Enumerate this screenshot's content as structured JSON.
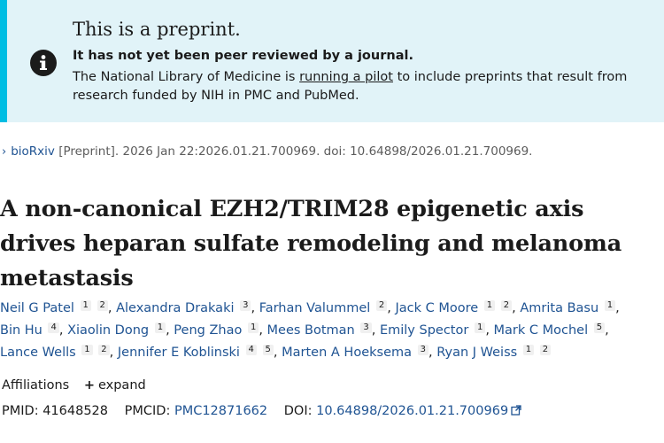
{
  "banner": {
    "heading": "This is a preprint.",
    "strong": "It has not yet been peer reviewed by a journal.",
    "text_before": "The National Library of Medicine is ",
    "link": "running a pilot",
    "text_after": " to include preprints that result from research funded by NIH in PMC and PubMed.",
    "icon": "info-circle-icon"
  },
  "citation": {
    "chevron": "›",
    "journal": "bioRxiv",
    "rest": " [Preprint]. 2026 Jan 22:2026.01.21.700969. doi: 10.64898/2026.01.21.700969."
  },
  "title": "A non-canonical EZH2/TRIM28 epigenetic axis drives heparan sulfate remodeling and melanoma metastasis",
  "authors": [
    {
      "name": "Neil G Patel",
      "affils": "1 2"
    },
    {
      "name": "Alexandra Drakaki",
      "affils": "3"
    },
    {
      "name": "Farhan Valummel",
      "affils": "2"
    },
    {
      "name": "Jack C Moore",
      "affils": "1 2"
    },
    {
      "name": "Amrita Basu",
      "affils": "1"
    },
    {
      "name": "Bin Hu",
      "affils": "4"
    },
    {
      "name": "Xiaolin Dong",
      "affils": "1"
    },
    {
      "name": "Peng Zhao",
      "affils": "1"
    },
    {
      "name": "Mees Botman",
      "affils": "3"
    },
    {
      "name": "Emily Spector",
      "affils": "1"
    },
    {
      "name": "Mark C Mochel",
      "affils": "5"
    },
    {
      "name": "Lance Wells",
      "affils": "1 2"
    },
    {
      "name": "Jennifer E Koblinski",
      "affils": "4 5"
    },
    {
      "name": "Marten A Hoeksema",
      "affils": "3"
    },
    {
      "name": "Ryan J Weiss",
      "affils": "1 2"
    }
  ],
  "affiliations": {
    "label": "Affiliations",
    "expand_icon": "plus",
    "expand_label": "expand"
  },
  "ids": {
    "pmid_label": "PMID:",
    "pmid": "41648528",
    "pmcid_label": "PMCID:",
    "pmcid": "PMC12871662",
    "doi_label": "DOI:",
    "doi": "10.64898/2026.01.21.700969",
    "doi_icon": "external-link-icon"
  },
  "colors": {
    "banner_bg": "#e1f3f8",
    "banner_border": "#00bde3",
    "link": "#205493"
  }
}
